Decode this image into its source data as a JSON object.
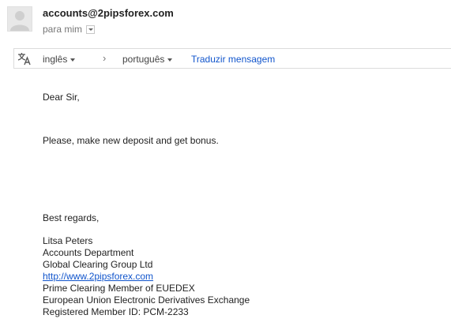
{
  "header": {
    "sender_email": "accounts@2pipsforex.com",
    "recipient_label": "para mim"
  },
  "translate_bar": {
    "source_language": "inglês",
    "target_language": "português",
    "translate_link": "Traduzir mensagem"
  },
  "message": {
    "greeting": "Dear Sir,",
    "body": "Please, make new deposit and get bonus.",
    "closing": "Best regards,"
  },
  "signature": {
    "name": "Litsa Peters",
    "department": "Accounts Department",
    "company": "Global Clearing Group Ltd",
    "website": "http://www.2pipsforex.com",
    "membership": "Prime Clearing Member of EUEDEX",
    "exchange": "European Union Electronic Derivatives Exchange",
    "member_id": "Registered Member ID: PCM-2233"
  },
  "icons": {
    "avatar": "avatar-placeholder-icon",
    "translate": "translate-icon",
    "recipient_dropdown": "chevron-down-icon",
    "language_arrow": "chevron-right-icon"
  },
  "colors": {
    "link": "#1155cc",
    "muted": "#777777",
    "border": "#dcdcdc"
  }
}
